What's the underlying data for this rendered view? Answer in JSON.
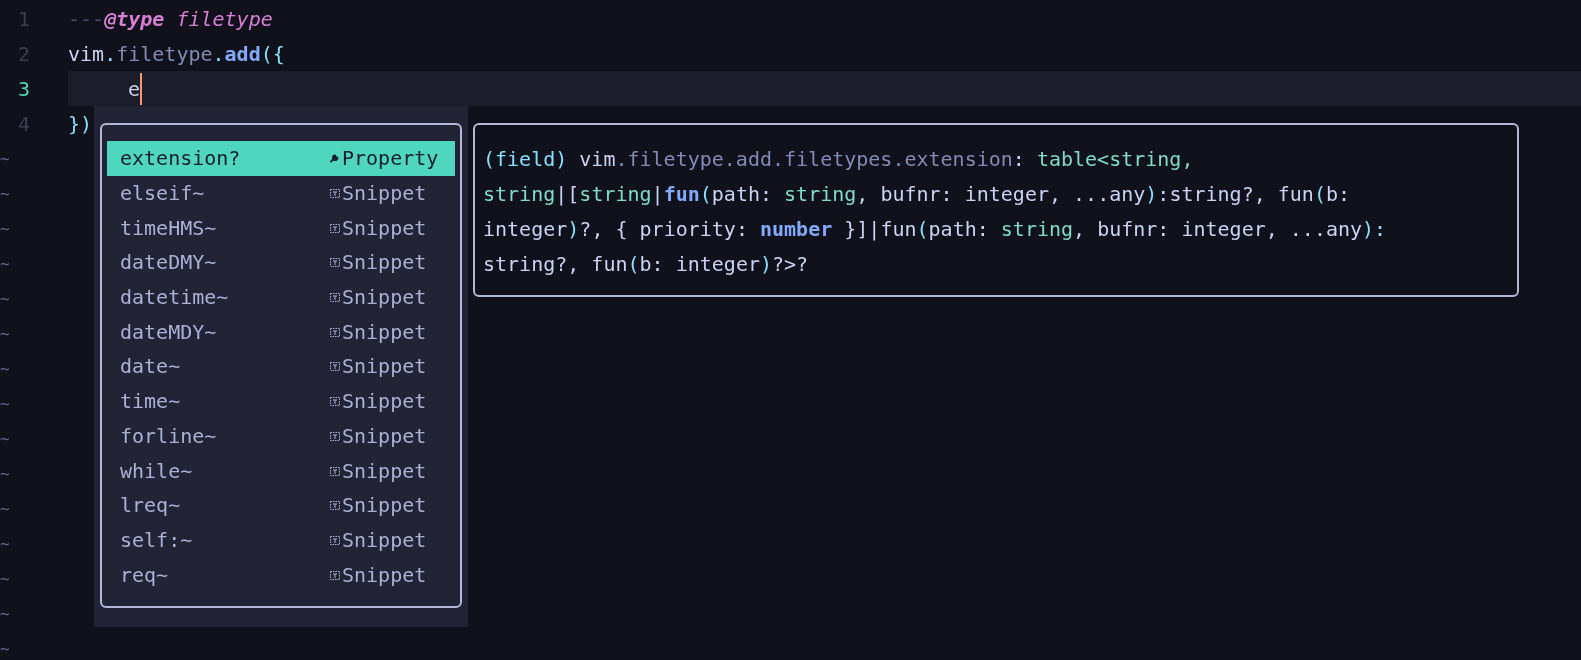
{
  "editor": {
    "lines": [
      {
        "number": "1",
        "current": false,
        "indent": false,
        "tokens": [
          {
            "text": "---",
            "kind": "comment"
          },
          {
            "text": "@type",
            "kind": "tag"
          },
          {
            "text": " filetype",
            "kind": "doc_type"
          }
        ]
      },
      {
        "number": "2",
        "current": false,
        "indent": false,
        "tokens": [
          {
            "text": "vim",
            "kind": "plain"
          },
          {
            "text": ".",
            "kind": "punct"
          },
          {
            "text": "filetype",
            "kind": "member"
          },
          {
            "text": ".",
            "kind": "punct"
          },
          {
            "text": "add",
            "kind": "func"
          },
          {
            "text": "({",
            "kind": "punct"
          }
        ]
      },
      {
        "number": "3",
        "current": true,
        "indent": true,
        "tokens": [
          {
            "text": "e",
            "kind": "plain"
          }
        ]
      },
      {
        "number": "4",
        "current": false,
        "indent": false,
        "tokens": [
          {
            "text": "})",
            "kind": "punct"
          }
        ]
      }
    ],
    "end_of_buffer": [
      "~",
      "~",
      "~",
      "~",
      "~",
      "~",
      "~",
      "~",
      "~",
      "~",
      "~",
      "~",
      "~",
      "~",
      "~"
    ]
  },
  "completion": {
    "items": [
      {
        "label": "extension?",
        "kind": "property",
        "kind_label": "Property",
        "selected": true
      },
      {
        "label": "elseif~",
        "kind": "snippet",
        "kind_label": "Snippet",
        "selected": false
      },
      {
        "label": "timeHMS~",
        "kind": "snippet",
        "kind_label": "Snippet",
        "selected": false
      },
      {
        "label": "dateDMY~",
        "kind": "snippet",
        "kind_label": "Snippet",
        "selected": false
      },
      {
        "label": "datetime~",
        "kind": "snippet",
        "kind_label": "Snippet",
        "selected": false
      },
      {
        "label": "dateMDY~",
        "kind": "snippet",
        "kind_label": "Snippet",
        "selected": false
      },
      {
        "label": "date~",
        "kind": "snippet",
        "kind_label": "Snippet",
        "selected": false
      },
      {
        "label": "time~",
        "kind": "snippet",
        "kind_label": "Snippet",
        "selected": false
      },
      {
        "label": "forline~",
        "kind": "snippet",
        "kind_label": "Snippet",
        "selected": false
      },
      {
        "label": "while~",
        "kind": "snippet",
        "kind_label": "Snippet",
        "selected": false
      },
      {
        "label": "lreq~",
        "kind": "snippet",
        "kind_label": "Snippet",
        "selected": false
      },
      {
        "label": "self:~",
        "kind": "snippet",
        "kind_label": "Snippet",
        "selected": false
      },
      {
        "label": "req~",
        "kind": "snippet",
        "kind_label": "Snippet",
        "selected": false
      }
    ]
  },
  "documentation": {
    "lines": [
      [
        {
          "text": "(field) ",
          "kind": "label"
        },
        {
          "text": "vim",
          "kind": "plain"
        },
        {
          "text": ".filetype.add.filetypes.extension",
          "kind": "member"
        },
        {
          "text": ": ",
          "kind": "plain"
        },
        {
          "text": "table<string,",
          "kind": "type"
        }
      ],
      [
        {
          "text": "string",
          "kind": "type"
        },
        {
          "text": "|[",
          "kind": "plain"
        },
        {
          "text": "string",
          "kind": "type"
        },
        {
          "text": "|",
          "kind": "plain"
        },
        {
          "text": "fun",
          "kind": "keyword"
        },
        {
          "text": "(",
          "kind": "punct"
        },
        {
          "text": "path: ",
          "kind": "plain"
        },
        {
          "text": "string",
          "kind": "type"
        },
        {
          "text": ", bufnr: integer, ...any",
          "kind": "plain"
        },
        {
          "text": ")",
          "kind": "punct"
        },
        {
          "text": ":string?, fun",
          "kind": "plain"
        },
        {
          "text": "(",
          "kind": "punct"
        },
        {
          "text": "b:",
          "kind": "plain"
        }
      ],
      [
        {
          "text": "integer",
          "kind": "plain"
        },
        {
          "text": ")",
          "kind": "punct"
        },
        {
          "text": "?, { priority: ",
          "kind": "plain"
        },
        {
          "text": "number",
          "kind": "keyword"
        },
        {
          "text": " }]|fun",
          "kind": "plain"
        },
        {
          "text": "(",
          "kind": "punct"
        },
        {
          "text": "path: ",
          "kind": "plain"
        },
        {
          "text": "string",
          "kind": "type"
        },
        {
          "text": ", bufnr: integer, ...any",
          "kind": "plain"
        },
        {
          "text": "):",
          "kind": "punct"
        }
      ],
      [
        {
          "text": "string?, fun",
          "kind": "plain"
        },
        {
          "text": "(",
          "kind": "punct"
        },
        {
          "text": "b: integer",
          "kind": "plain"
        },
        {
          "text": ")",
          "kind": "punct"
        },
        {
          "text": "?>?",
          "kind": "plain"
        }
      ]
    ]
  }
}
